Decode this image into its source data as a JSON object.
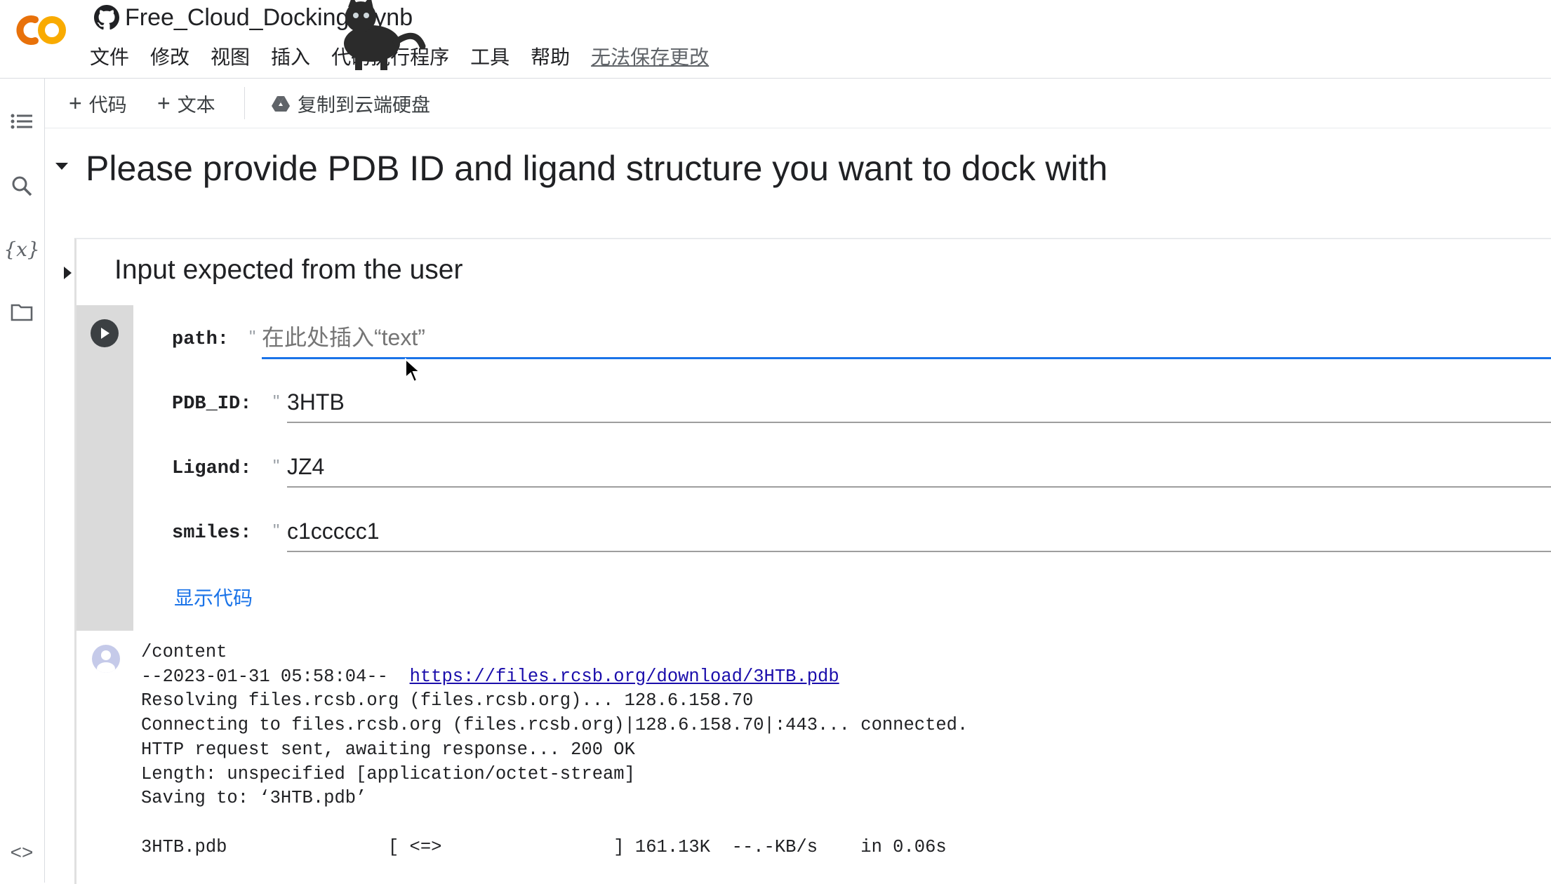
{
  "header": {
    "notebook_title": "Free_Cloud_Docking.ipynb",
    "menu": [
      "文件",
      "修改",
      "视图",
      "插入",
      "代码执行程序",
      "工具",
      "帮助"
    ],
    "unsaved_notice": "无法保存更改"
  },
  "toolbar": {
    "add_code_label": "代码",
    "add_text_label": "文本",
    "copy_to_drive_label": "复制到云端硬盘"
  },
  "sidebar": {
    "icons": [
      "table-of-contents-icon",
      "search-icon",
      "variables-icon",
      "folder-icon"
    ],
    "bottom_icon": "code-snippets-icon"
  },
  "notebook": {
    "heading": "Please provide PDB ID and ligand structure you want to dock with",
    "subheading": "Input expected from the user",
    "form": {
      "path": {
        "label": "path:",
        "value": "",
        "placeholder": "在此处插入“text”"
      },
      "pdb_id": {
        "label": "PDB_ID:",
        "value": "3HTB"
      },
      "ligand": {
        "label": "Ligand:",
        "value": "JZ4"
      },
      "smiles": {
        "label": "smiles:",
        "value": "c1ccccc1"
      },
      "quote_mark": "\""
    },
    "show_code_label": "显示代码",
    "output": {
      "lines": [
        "/content",
        "--2023-01-31 05:58:04--  ",
        "Resolving files.rcsb.org (files.rcsb.org)... 128.6.158.70",
        "Connecting to files.rcsb.org (files.rcsb.org)|128.6.158.70|:443... connected.",
        "HTTP request sent, awaiting response... 200 OK",
        "Length: unspecified [application/octet-stream]",
        "Saving to: ‘3HTB.pdb’",
        "",
        "3HTB.pdb               [ <=>                ] 161.13K  --.-KB/s    in 0.06s"
      ],
      "link": "https://files.rcsb.org/download/3HTB.pdb"
    }
  },
  "colors": {
    "accent_blue": "#1a73e8",
    "colab_orange": "#f9ab00",
    "colab_dark_orange": "#e8710a",
    "gutter_gray": "#dadada"
  }
}
